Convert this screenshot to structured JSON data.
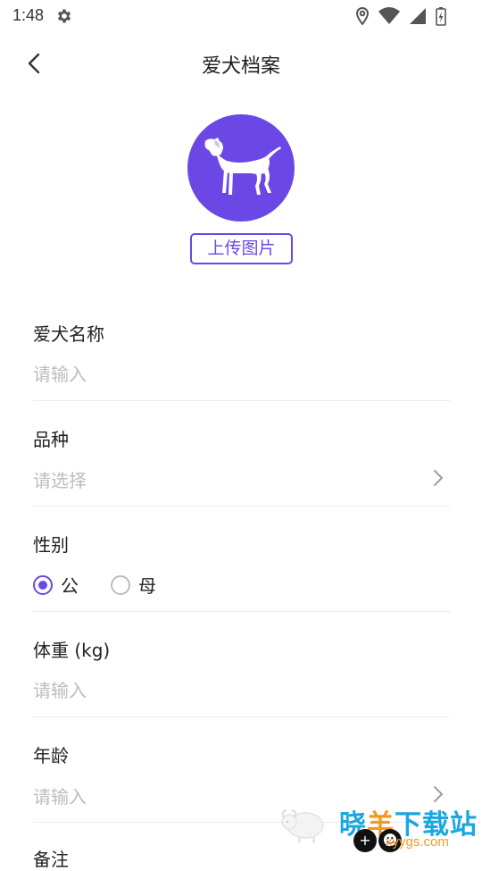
{
  "status_bar": {
    "time": "1:48",
    "icons": [
      "settings-gear-icon",
      "location-icon",
      "wifi-icon",
      "signal-icon",
      "battery-charging-icon"
    ]
  },
  "header": {
    "back_icon": "chevron-left-icon",
    "title": "爱犬档案"
  },
  "avatar": {
    "icon": "dog-icon",
    "color": "#6b48e6"
  },
  "upload_label": "上传图片",
  "form": {
    "name": {
      "label": "爱犬名称",
      "placeholder": "请输入"
    },
    "breed": {
      "label": "品种",
      "placeholder": "请选择"
    },
    "gender": {
      "label": "性别",
      "options": [
        {
          "label": "公",
          "checked": true
        },
        {
          "label": "母",
          "checked": false
        }
      ]
    },
    "weight": {
      "label": "体重 (kg)",
      "placeholder": "请输入"
    },
    "age": {
      "label": "年龄",
      "placeholder": "请输入"
    },
    "notes": {
      "label": "备注"
    }
  },
  "watermark": {
    "logo_icon": "sheep-logo-icon",
    "title_blue": "晓",
    "title_orange": "羊",
    "title_rest": "下载站",
    "url": "xyygs.com"
  },
  "colors": {
    "accent": "#6b48e6",
    "placeholder": "#bdbdbd",
    "divider": "#ececec",
    "watermark_blue": "#19a7e0",
    "watermark_orange": "#f39a1e"
  }
}
